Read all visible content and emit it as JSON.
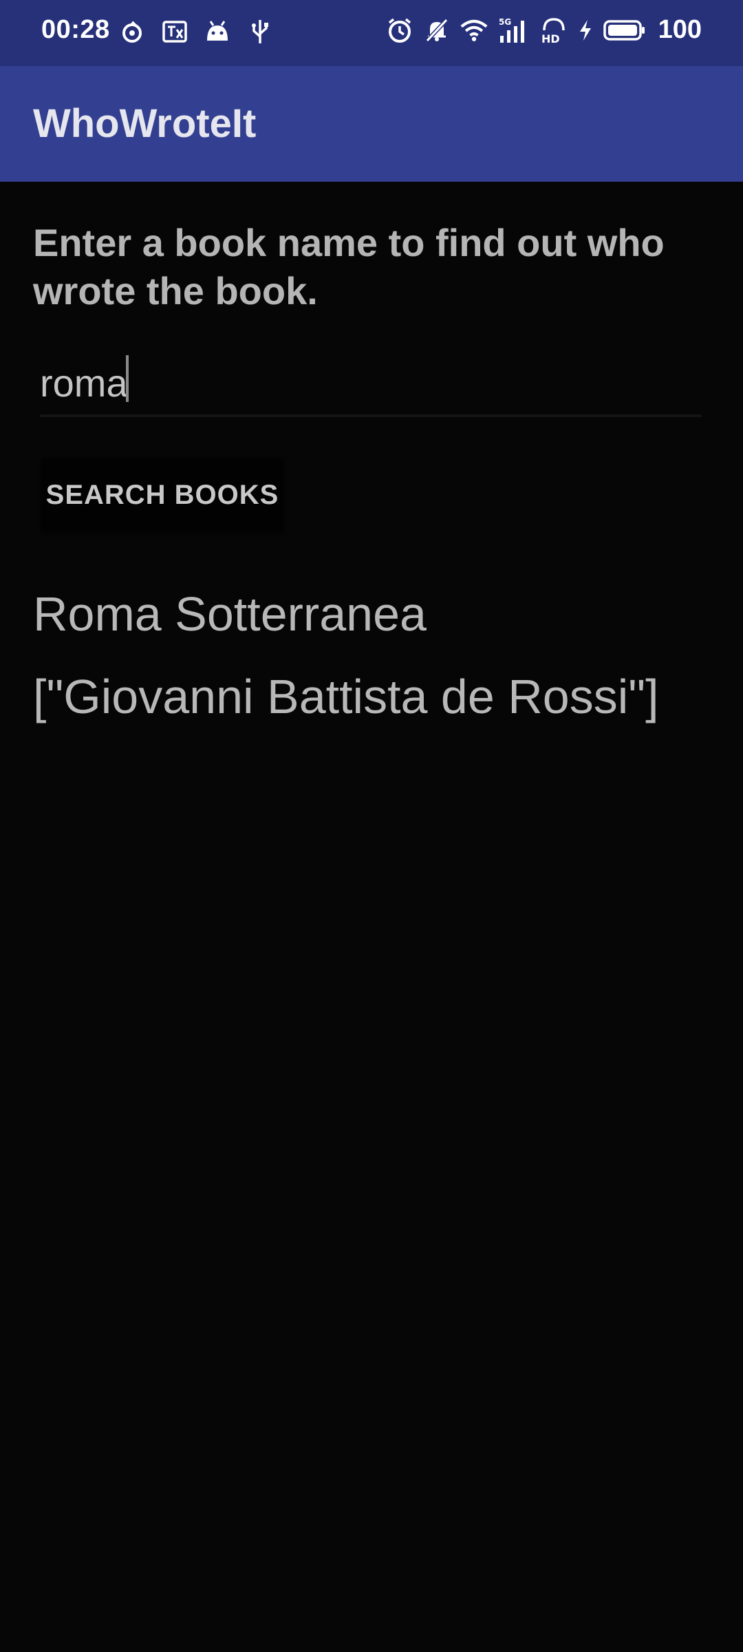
{
  "status_bar": {
    "time": "00:28",
    "battery": "100",
    "left_icons": [
      "hotspot-icon",
      "translate-icon",
      "android-debug-icon",
      "usb-icon"
    ],
    "right_icons": [
      "alarm-icon",
      "silent-bell-icon",
      "wifi-icon",
      "5g-signal-icon",
      "hd-icon",
      "charging-icon",
      "battery-icon"
    ]
  },
  "app_bar": {
    "title": "WhoWroteIt"
  },
  "main": {
    "instructions": "Enter a book name to find out who wrote the book.",
    "search_input": {
      "value": "roma",
      "placeholder": ""
    },
    "search_button_label": "SEARCH BOOKS",
    "result": {
      "title": "Roma Sotterranea",
      "authors": "[\"Giovanni Battista de Rossi\"]"
    }
  },
  "colors": {
    "status_bar": "#26317a",
    "app_bar": "#333f90",
    "background": "#060606",
    "text": "#b5b5b5"
  }
}
